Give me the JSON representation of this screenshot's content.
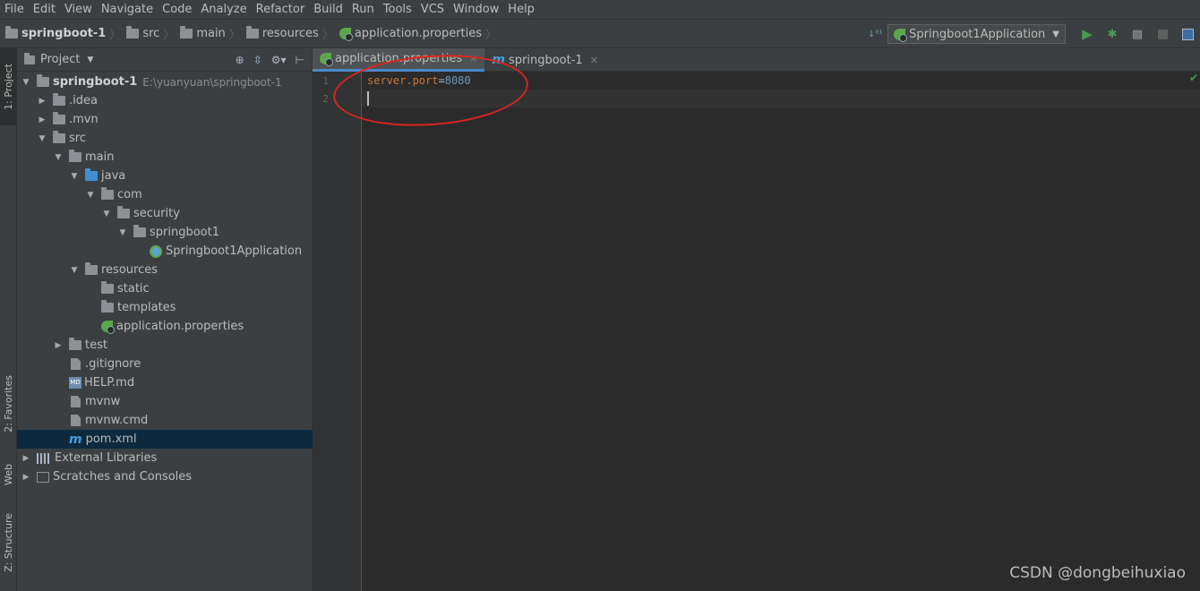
{
  "menu": [
    "File",
    "Edit",
    "View",
    "Navigate",
    "Code",
    "Analyze",
    "Refactor",
    "Build",
    "Run",
    "Tools",
    "VCS",
    "Window",
    "Help"
  ],
  "breadcrumbs": [
    "springboot-1",
    "src",
    "main",
    "resources",
    "application.properties"
  ],
  "run_config": "Springboot1Application",
  "left_tabs": [
    "1: Project",
    "2: Favorites",
    "Web",
    "Z: Structure"
  ],
  "project_panel": {
    "title": "Project"
  },
  "tree": [
    {
      "label": "springboot-1",
      "hint": "E:\\yuanyuan\\springboot-1",
      "indent": 0,
      "arrow": "▼",
      "icon": "folder",
      "bold": true
    },
    {
      "label": ".idea",
      "indent": 1,
      "arrow": "▶",
      "icon": "folder"
    },
    {
      "label": ".mvn",
      "indent": 1,
      "arrow": "▶",
      "icon": "folder"
    },
    {
      "label": "src",
      "indent": 1,
      "arrow": "▼",
      "icon": "folder"
    },
    {
      "label": "main",
      "indent": 2,
      "arrow": "▼",
      "icon": "folder"
    },
    {
      "label": "java",
      "indent": 3,
      "arrow": "▼",
      "icon": "folder-blue"
    },
    {
      "label": "com",
      "indent": 4,
      "arrow": "▼",
      "icon": "folder"
    },
    {
      "label": "security",
      "indent": 5,
      "arrow": "▼",
      "icon": "folder"
    },
    {
      "label": "springboot1",
      "indent": 6,
      "arrow": "▼",
      "icon": "folder"
    },
    {
      "label": "Springboot1Application",
      "indent": 7,
      "arrow": "",
      "icon": "class"
    },
    {
      "label": "resources",
      "indent": 3,
      "arrow": "▼",
      "icon": "folder"
    },
    {
      "label": "static",
      "indent": 4,
      "arrow": "",
      "icon": "folder"
    },
    {
      "label": "templates",
      "indent": 4,
      "arrow": "",
      "icon": "folder"
    },
    {
      "label": "application.properties",
      "indent": 4,
      "arrow": "",
      "icon": "spring"
    },
    {
      "label": "test",
      "indent": 2,
      "arrow": "▶",
      "icon": "folder"
    },
    {
      "label": ".gitignore",
      "indent": 2,
      "arrow": "",
      "icon": "file"
    },
    {
      "label": "HELP.md",
      "indent": 2,
      "arrow": "",
      "icon": "md"
    },
    {
      "label": "mvnw",
      "indent": 2,
      "arrow": "",
      "icon": "file"
    },
    {
      "label": "mvnw.cmd",
      "indent": 2,
      "arrow": "",
      "icon": "file"
    },
    {
      "label": "pom.xml",
      "indent": 2,
      "arrow": "",
      "icon": "maven",
      "selected": true
    },
    {
      "label": "External Libraries",
      "indent": 0,
      "arrow": "▶",
      "icon": "lib"
    },
    {
      "label": "Scratches and Consoles",
      "indent": 0,
      "arrow": "▶",
      "icon": "scratch"
    }
  ],
  "editor_tabs": [
    {
      "label": "application.properties",
      "icon": "spring",
      "active": true
    },
    {
      "label": "springboot-1",
      "icon": "maven",
      "active": false
    }
  ],
  "editor": {
    "line_numbers": [
      "1",
      "2"
    ],
    "key": "server.port",
    "eq": "=",
    "value": "8080"
  },
  "watermark": "CSDN @dongbeihuxiao",
  "colors": {
    "accent": "#4a88c7",
    "annotation": "#d8261c",
    "key": "#cc7832",
    "number": "#6897bb"
  }
}
